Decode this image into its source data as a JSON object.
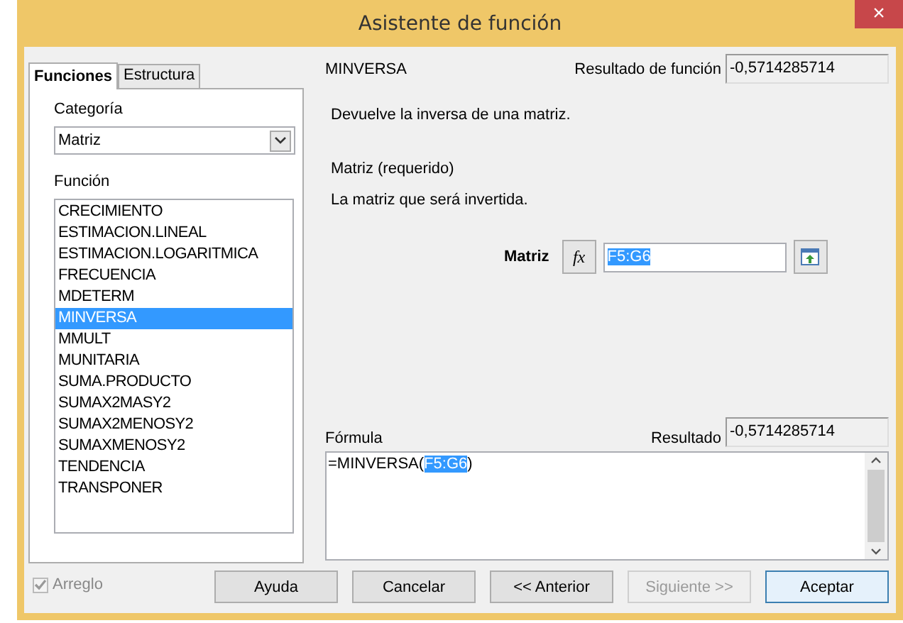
{
  "window": {
    "title": "Asistente de función",
    "close": "×"
  },
  "tabs": [
    {
      "label": "Funciones",
      "selected": true
    },
    {
      "label": "Estructura",
      "selected": false
    }
  ],
  "category": {
    "label": "Categoría",
    "value": "Matriz"
  },
  "function_list": {
    "label": "Función",
    "items": [
      {
        "label": "CRECIMIENTO",
        "selected": false
      },
      {
        "label": "ESTIMACION.LINEAL",
        "selected": false
      },
      {
        "label": "ESTIMACION.LOGARITMICA",
        "selected": false
      },
      {
        "label": "FRECUENCIA",
        "selected": false
      },
      {
        "label": "MDETERM",
        "selected": false
      },
      {
        "label": "MINVERSA",
        "selected": true
      },
      {
        "label": "MMULT",
        "selected": false
      },
      {
        "label": "MUNITARIA",
        "selected": false
      },
      {
        "label": "SUMA.PRODUCTO",
        "selected": false
      },
      {
        "label": "SUMAX2MASY2",
        "selected": false
      },
      {
        "label": "SUMAX2MENOSY2",
        "selected": false
      },
      {
        "label": "SUMAXMENOSY2",
        "selected": false
      },
      {
        "label": "TENDENCIA",
        "selected": false
      },
      {
        "label": "TRANSPONER",
        "selected": false
      }
    ]
  },
  "array_option": {
    "label": "Arreglo",
    "checked": true,
    "disabled": true
  },
  "function_name": "MINVERSA",
  "function_result": {
    "label": "Resultado de función",
    "value": "-0,5714285714"
  },
  "description": "Devuelve la inversa de una matriz.",
  "argument_title": "Matriz (requerido)",
  "argument_description": "La matriz que será invertida.",
  "argument": {
    "label": "Matriz",
    "fx": "fx",
    "value": "F5:G6",
    "value_selected": true
  },
  "formula": {
    "label": "Fórmula",
    "before": "=MINVERSA(",
    "selected_part": "F5:G6",
    "after": ")"
  },
  "result": {
    "label": "Resultado",
    "value": "-0,5714285714"
  },
  "buttons": [
    {
      "label": "Ayuda",
      "disabled": false,
      "default": false
    },
    {
      "label": "Cancelar",
      "disabled": false,
      "default": false
    },
    {
      "label": "<< Anterior",
      "disabled": false,
      "default": false
    },
    {
      "label": "Siguiente >>",
      "disabled": true,
      "default": false
    },
    {
      "label": "Aceptar",
      "disabled": false,
      "default": true
    }
  ]
}
